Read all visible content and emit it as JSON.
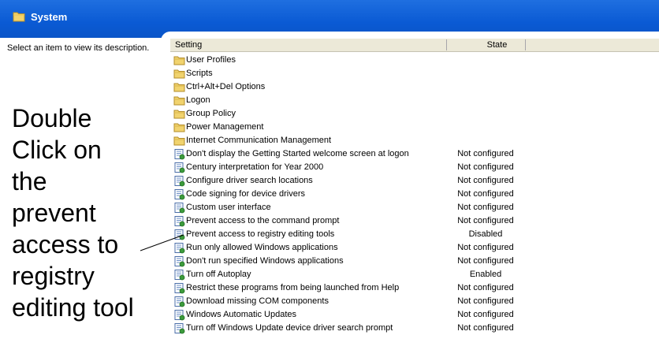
{
  "window": {
    "title": "System",
    "title_bar_color": "#0a5ad4"
  },
  "description_pane": {
    "text": "Select an item to view its description."
  },
  "list": {
    "columns": [
      "Setting",
      "State"
    ],
    "rows": [
      {
        "icon": "folder-icon",
        "label": "User Profiles",
        "state": ""
      },
      {
        "icon": "folder-icon",
        "label": "Scripts",
        "state": ""
      },
      {
        "icon": "folder-icon",
        "label": "Ctrl+Alt+Del Options",
        "state": ""
      },
      {
        "icon": "folder-icon",
        "label": "Logon",
        "state": ""
      },
      {
        "icon": "folder-icon",
        "label": "Group Policy",
        "state": ""
      },
      {
        "icon": "folder-icon",
        "label": "Power Management",
        "state": ""
      },
      {
        "icon": "folder-icon",
        "label": "Internet Communication Management",
        "state": ""
      },
      {
        "icon": "policy-setting-icon",
        "label": "Don't display the Getting Started welcome screen at logon",
        "state": "Not configured"
      },
      {
        "icon": "policy-setting-icon",
        "label": "Century interpretation for Year 2000",
        "state": "Not configured"
      },
      {
        "icon": "policy-setting-icon",
        "label": "Configure driver search locations",
        "state": "Not configured"
      },
      {
        "icon": "policy-setting-icon",
        "label": "Code signing for device drivers",
        "state": "Not configured"
      },
      {
        "icon": "policy-setting-icon",
        "label": "Custom user interface",
        "state": "Not configured"
      },
      {
        "icon": "policy-setting-icon",
        "label": "Prevent access to the command prompt",
        "state": "Not configured"
      },
      {
        "icon": "policy-setting-icon",
        "label": "Prevent access to registry editing tools",
        "state": "Disabled"
      },
      {
        "icon": "policy-setting-icon",
        "label": "Run only allowed Windows applications",
        "state": "Not configured"
      },
      {
        "icon": "policy-setting-icon",
        "label": "Don't run specified Windows applications",
        "state": "Not configured"
      },
      {
        "icon": "policy-setting-icon",
        "label": "Turn off Autoplay",
        "state": "Enabled"
      },
      {
        "icon": "policy-setting-icon",
        "label": "Restrict these programs from being launched from Help",
        "state": "Not configured"
      },
      {
        "icon": "policy-setting-icon",
        "label": "Download missing COM components",
        "state": "Not configured"
      },
      {
        "icon": "policy-setting-icon",
        "label": "Windows Automatic Updates",
        "state": "Not configured"
      },
      {
        "icon": "policy-setting-icon",
        "label": "Turn off Windows Update device driver search prompt",
        "state": "Not configured"
      }
    ]
  },
  "annotation": {
    "lines": [
      "Double",
      "Click on",
      "the",
      "prevent",
      "access to",
      "registry",
      "editing tool"
    ]
  }
}
